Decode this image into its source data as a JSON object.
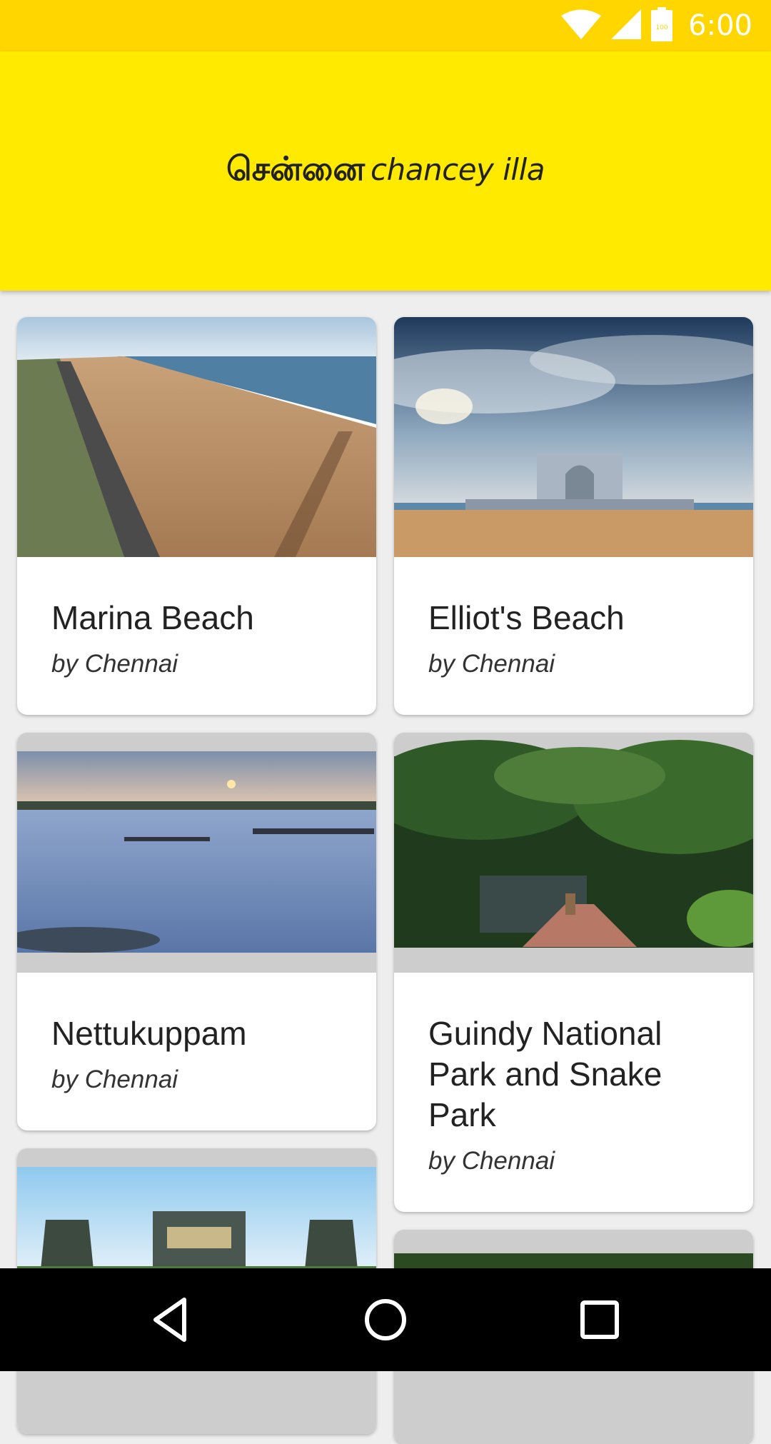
{
  "status_bar": {
    "time": "6:00",
    "battery_level": "100",
    "icons": [
      "wifi-icon",
      "cellular-signal-icon",
      "battery-icon"
    ]
  },
  "header": {
    "title_tamil": "சென்னை",
    "title_latin": "chancey illa",
    "background_color": "#ffea00"
  },
  "places": [
    {
      "name": "Marina Beach",
      "subtitle": "by Chennai"
    },
    {
      "name": "Elliot's Beach",
      "subtitle": "by Chennai"
    },
    {
      "name": "Nettukuppam",
      "subtitle": "by Chennai"
    },
    {
      "name": "Guindy National Park and Snake Park",
      "subtitle": "by Chennai"
    }
  ],
  "navigation": {
    "buttons": [
      "back-icon",
      "home-icon",
      "recents-icon"
    ]
  }
}
